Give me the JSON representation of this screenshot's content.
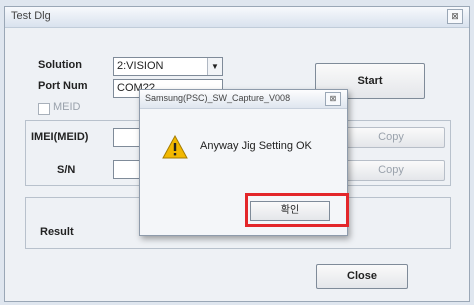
{
  "window": {
    "title": "Test Dlg",
    "close_label": "⊠"
  },
  "form": {
    "solution_label": "Solution",
    "solution_value": "2:VISION",
    "port_label": "Port Num",
    "port_value": "COM??",
    "meid_label": "MEID",
    "imei_label": "IMEI(MEID)",
    "sn_label": "S/N",
    "result_label": "Result"
  },
  "buttons": {
    "start": "Start",
    "copy1": "Copy",
    "copy2": "Copy",
    "close": "Close"
  },
  "dialog": {
    "title": "Samsung(PSC)_SW_Capture_V008",
    "close_label": "⊠",
    "message": "Anyway Jig Setting OK",
    "ok_label": "확인"
  },
  "colors": {
    "highlight": "#e3262a",
    "warning": "#f2b800"
  }
}
